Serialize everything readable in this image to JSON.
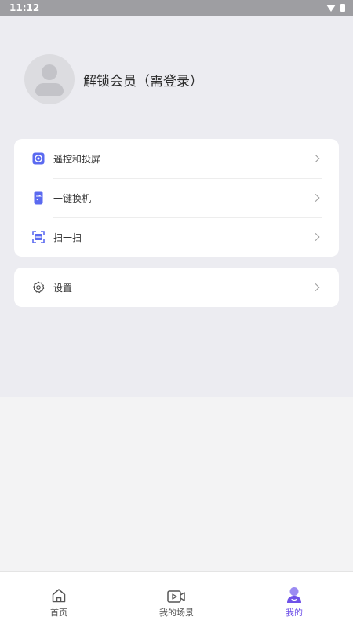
{
  "status_bar": {
    "time": "11:12"
  },
  "profile": {
    "label": "解锁会员（需登录）"
  },
  "menu_group_1": [
    {
      "label": "遥控和投屏",
      "icon": "remote-control-icon"
    },
    {
      "label": "一键换机",
      "icon": "phone-switch-icon"
    },
    {
      "label": "扫一扫",
      "icon": "scan-icon"
    }
  ],
  "menu_group_2": [
    {
      "label": "设置",
      "icon": "settings-gear-icon"
    }
  ],
  "tabbar": [
    {
      "label": "首页",
      "icon": "home-icon"
    },
    {
      "label": "我的场景",
      "icon": "video-icon"
    },
    {
      "label": "我的",
      "icon": "user-icon"
    }
  ],
  "colors": {
    "accent": "#6f52e8",
    "icon_accent": "#5b6af0",
    "top_background": "#ececf1",
    "page_background": "#f3f3f4"
  }
}
